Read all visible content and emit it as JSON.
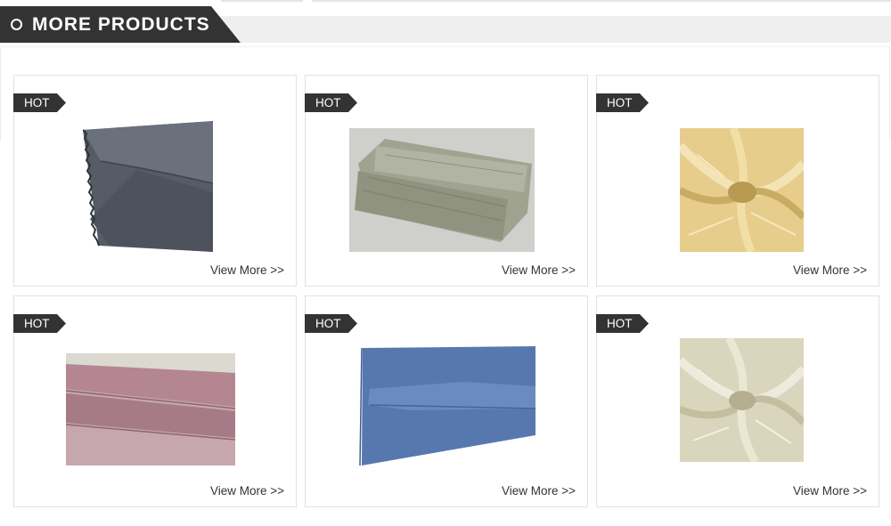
{
  "section": {
    "title": "MORE PRODUCTS"
  },
  "products": [
    {
      "badge": "HOT",
      "link_label": "View More >>",
      "fabric_color": "#5f6470"
    },
    {
      "badge": "HOT",
      "link_label": "View More >>",
      "fabric_color": "#9ba08e"
    },
    {
      "badge": "HOT",
      "link_label": "View More >>",
      "fabric_color": "#e2c782"
    },
    {
      "badge": "HOT",
      "link_label": "View More >>",
      "fabric_color": "#b88a99"
    },
    {
      "badge": "HOT",
      "link_label": "View More >>",
      "fabric_color": "#5a7fb6"
    },
    {
      "badge": "HOT",
      "link_label": "View More >>",
      "fabric_color": "#ddd9c2"
    }
  ]
}
